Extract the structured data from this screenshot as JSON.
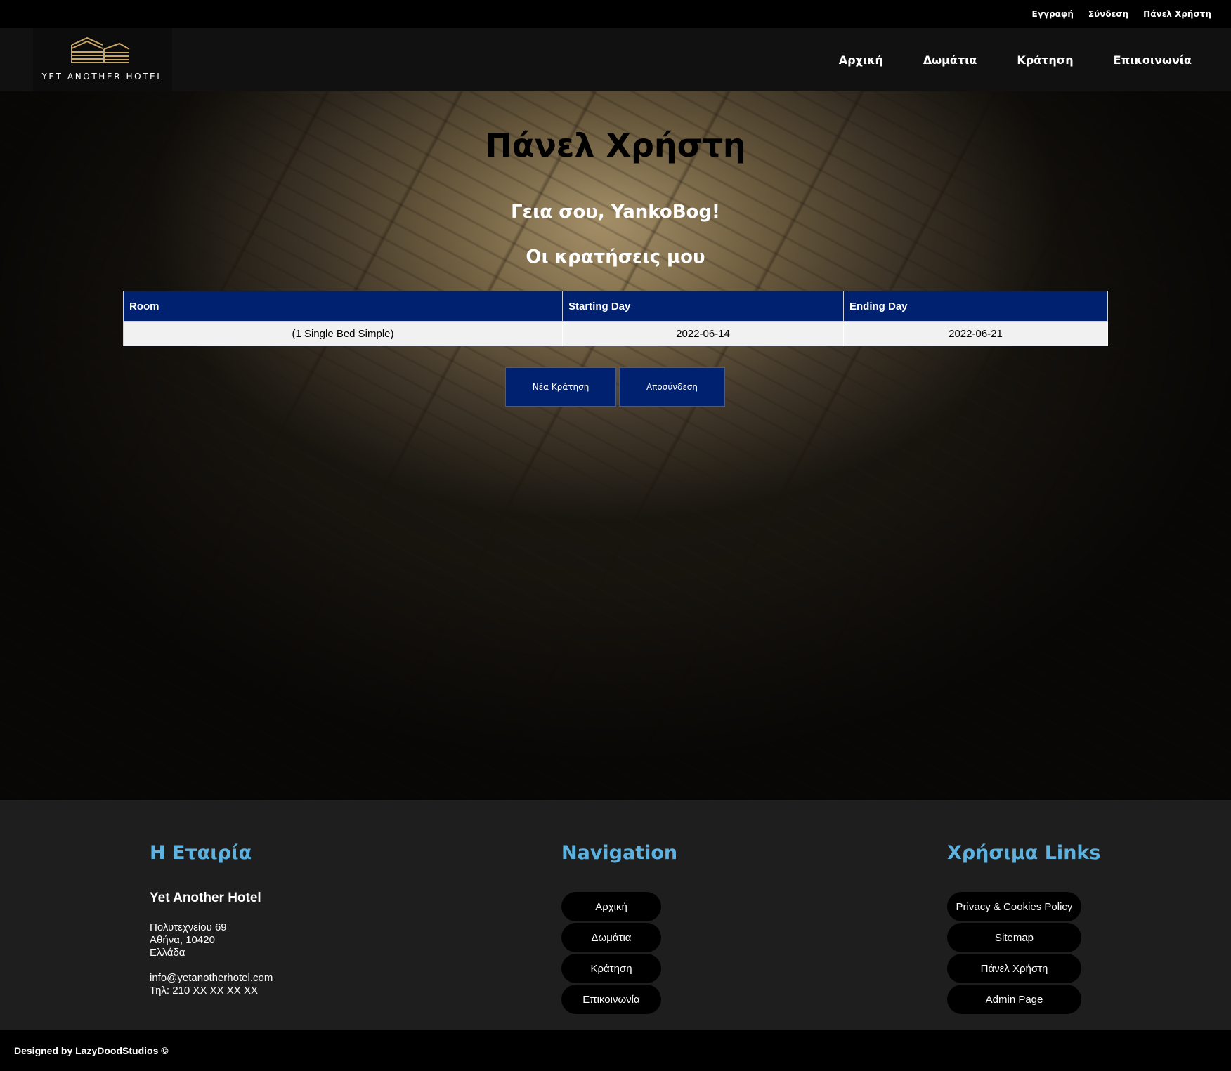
{
  "topbar": {
    "register": "Εγγραφή",
    "login": "Σύνδεση",
    "user_panel": "Πάνελ Χρήστη"
  },
  "header": {
    "logo_text": "YET ANOTHER HOTEL",
    "nav": {
      "home": "Αρχική",
      "rooms": "Δωμάτια",
      "booking": "Κράτηση",
      "contact": "Επικοινωνία"
    }
  },
  "main": {
    "title": "Πάνελ Χρήστη",
    "greeting": "Γεια σου, YankoBog!",
    "bookings_heading": "Οι κρατήσεις μου",
    "table": {
      "headers": [
        "Room",
        "Starting Day",
        "Ending Day"
      ],
      "rows": [
        [
          "(1 Single Bed Simple)",
          "2022-06-14",
          "2022-06-21"
        ]
      ]
    },
    "new_booking_button": "Νέα Κράτηση",
    "logout_button": "Αποσύνδεση"
  },
  "footer": {
    "company": {
      "heading": "Η Εταιρία",
      "name": "Yet Another Hotel",
      "address_line1": "Πολυτεχνείου 69",
      "address_line2": "Αθήνα, 10420",
      "address_line3": "Ελλάδα",
      "email": "info@yetanotherhotel.com",
      "phone": "Τηλ: 210 XX XX XX XX"
    },
    "navigation": {
      "heading": "Navigation",
      "links": [
        "Αρχική",
        "Δωμάτια",
        "Κράτηση",
        "Επικοινωνία"
      ]
    },
    "useful_links": {
      "heading": "Χρήσιμα Links",
      "links": [
        "Privacy & Cookies Policy",
        "Sitemap",
        "Πάνελ Χρήστη",
        "Admin Page"
      ]
    }
  },
  "bottom": {
    "credit": "Designed by LazyDoodStudios ©"
  },
  "colors": {
    "accent_blue": "#002170",
    "footer_heading": "#5cb2e0",
    "logo_gold": "#c9a766"
  }
}
